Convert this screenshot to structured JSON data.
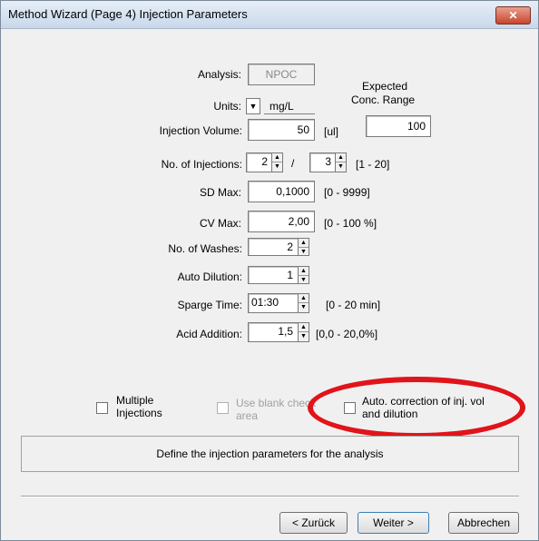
{
  "window": {
    "title": "Method Wizard (Page 4) Injection Parameters",
    "close_glyph": "✕"
  },
  "form": {
    "analysis": {
      "label": "Analysis:",
      "value": "NPOC"
    },
    "units": {
      "label": "Units:",
      "value": "mg/L",
      "dropdown_glyph": "▼"
    },
    "expected_conc": {
      "label_line1": "Expected",
      "label_line2": "Conc. Range",
      "value": "100"
    },
    "injection_volume": {
      "label": "Injection Volume:",
      "value": "50",
      "unit": "[ul]"
    },
    "no_injections": {
      "label": "No. of Injections:",
      "value1": "2",
      "separator": "/",
      "value2": "3",
      "range": "[1 - 20]"
    },
    "sd_max": {
      "label": "SD Max:",
      "value": "0,1000",
      "range": "[0 - 9999]"
    },
    "cv_max": {
      "label": "CV Max:",
      "value": "2,00",
      "range": "[0 - 100 %]"
    },
    "no_washes": {
      "label": "No. of Washes:",
      "value": "2"
    },
    "auto_dilution": {
      "label": "Auto Dilution:",
      "value": "1"
    },
    "sparge_time": {
      "label": "Sparge Time:",
      "value": "01:30",
      "range": "[0 - 20 min]"
    },
    "acid_addition": {
      "label": "Acid Addition:",
      "value": "1,5",
      "range": "[0,0 - 20,0%]"
    }
  },
  "checkboxes": {
    "multiple": {
      "line1": "Multiple",
      "line2": "Injections"
    },
    "blank": {
      "line1": "Use blank check",
      "line2": "area"
    },
    "auto_corr": {
      "line1": "Auto. correction of inj. vol",
      "line2": "and dilution"
    }
  },
  "info": "Define the injection parameters for the analysis",
  "buttons": {
    "back": "< Zurück",
    "next": "Weiter >",
    "cancel": "Abbrechen"
  },
  "spin_glyphs": {
    "up": "▲",
    "down": "▼"
  },
  "colors": {
    "highlight": "#e0141a",
    "close": "#c8452c"
  }
}
